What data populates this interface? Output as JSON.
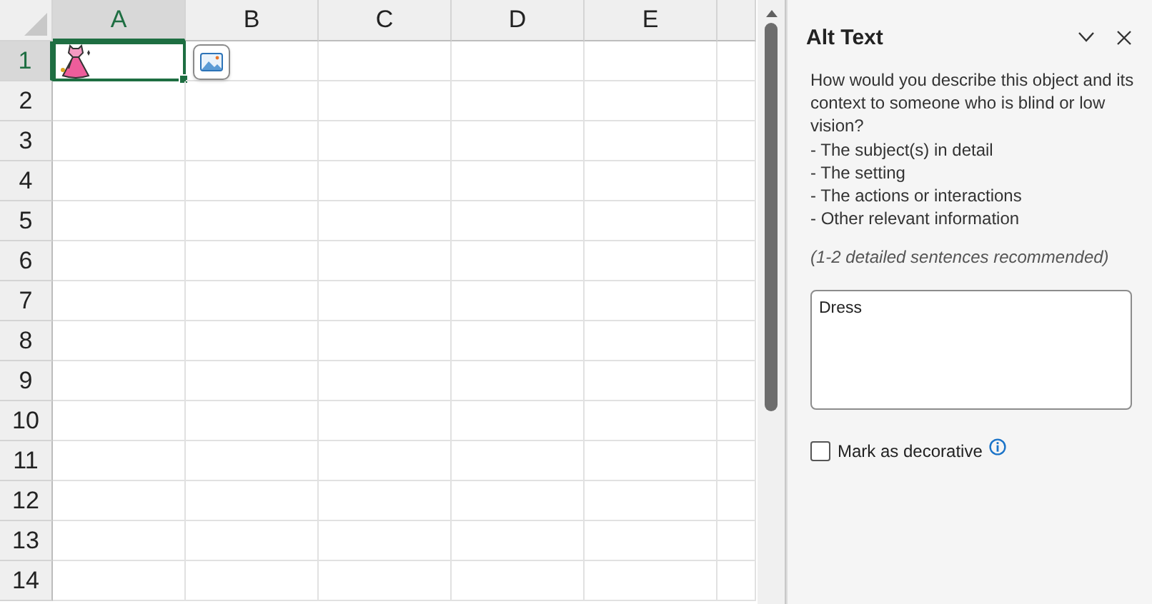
{
  "sheet": {
    "columns": [
      {
        "label": "A",
        "selected": true
      },
      {
        "label": "B",
        "selected": false
      },
      {
        "label": "C",
        "selected": false
      },
      {
        "label": "D",
        "selected": false
      },
      {
        "label": "E",
        "selected": false
      }
    ],
    "rows": [
      {
        "label": "1",
        "selected": true
      },
      {
        "label": "2",
        "selected": false
      },
      {
        "label": "3",
        "selected": false
      },
      {
        "label": "4",
        "selected": false
      },
      {
        "label": "5",
        "selected": false
      },
      {
        "label": "6",
        "selected": false
      },
      {
        "label": "7",
        "selected": false
      },
      {
        "label": "8",
        "selected": false
      },
      {
        "label": "9",
        "selected": false
      },
      {
        "label": "10",
        "selected": false
      },
      {
        "label": "11",
        "selected": false
      },
      {
        "label": "12",
        "selected": false
      },
      {
        "label": "13",
        "selected": false
      },
      {
        "label": "14",
        "selected": false
      }
    ]
  },
  "pane": {
    "title": "Alt Text",
    "intro": "How would you describe this object and its context to someone who is blind or low vision?",
    "bullets": [
      "- The subject(s) in detail",
      "- The setting",
      "- The actions or interactions",
      "- Other relevant information"
    ],
    "hint": "(1-2 detailed sentences recommended)",
    "alt_text": {
      "value": "Dress"
    },
    "decorative": {
      "label": "Mark as decorative",
      "checked": false
    }
  }
}
